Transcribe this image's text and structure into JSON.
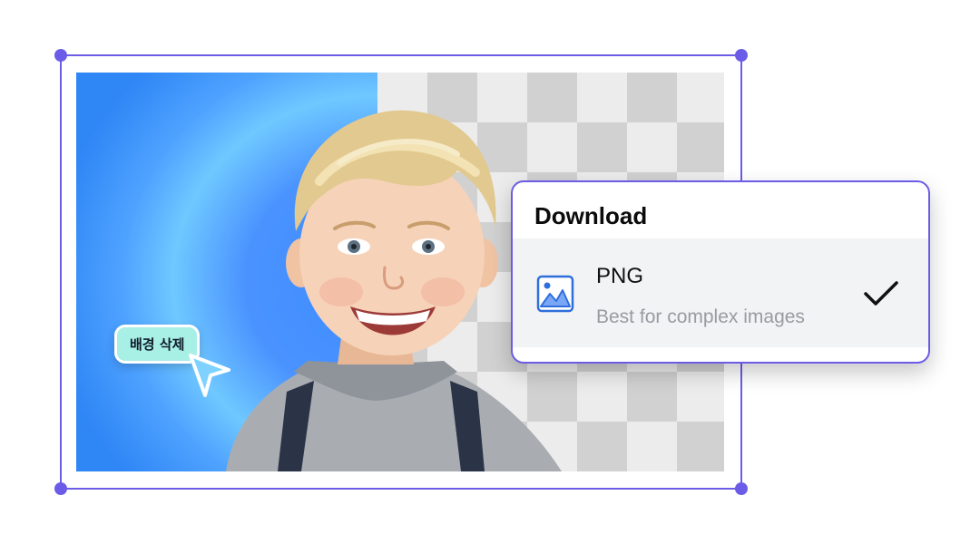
{
  "badge": {
    "label": "배경 삭제"
  },
  "download": {
    "title": "Download",
    "option": {
      "label": "PNG",
      "description": "Best for complex images",
      "icon": "image-icon",
      "selected": true
    }
  },
  "colors": {
    "accent": "#6b5ce7",
    "badge_bg": "#a8efe6",
    "background_blue": "#3d8bff",
    "option_row_bg": "#f2f3f5"
  }
}
